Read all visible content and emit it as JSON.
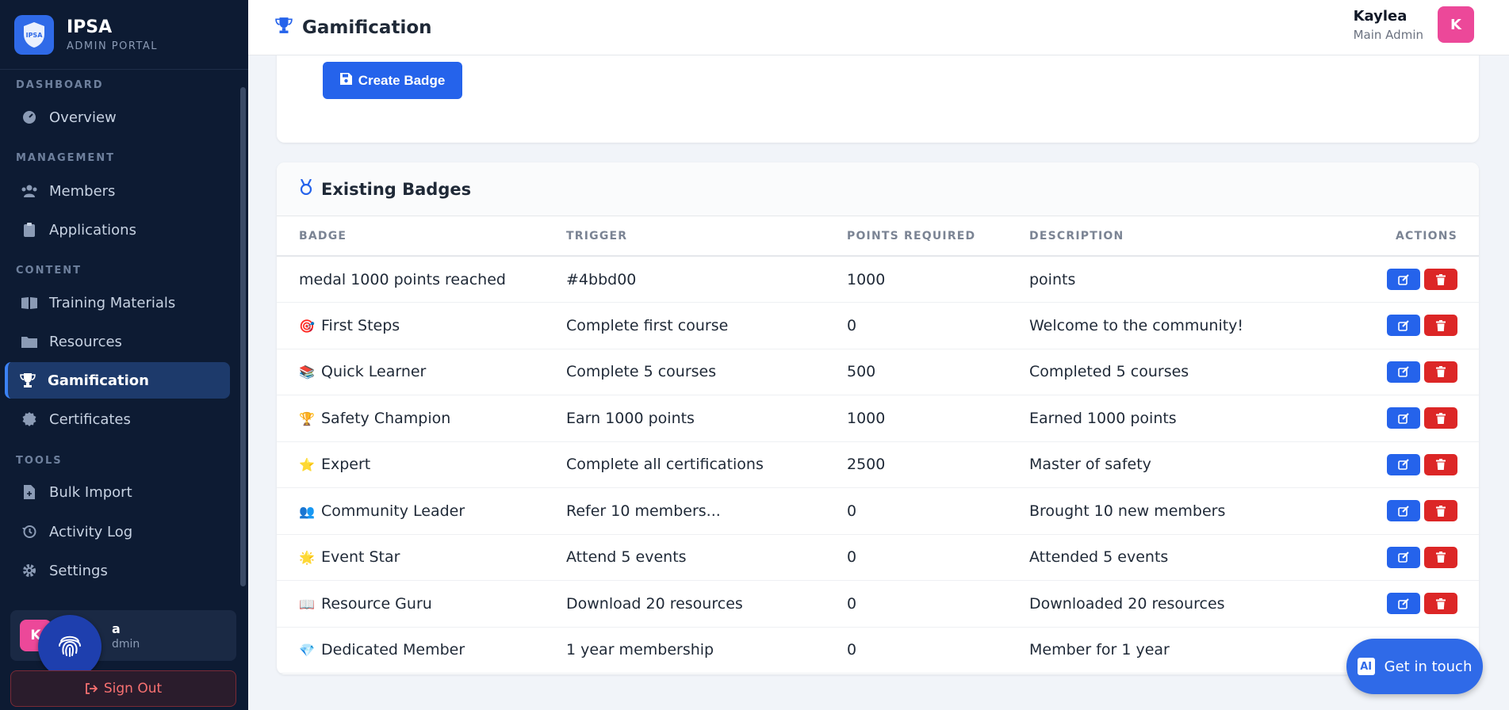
{
  "brand": {
    "title": "IPSA",
    "subtitle": "ADMIN PORTAL",
    "logo_text": "IPSA"
  },
  "sidebar": {
    "sections": [
      "DASHBOARD",
      "MANAGEMENT",
      "CONTENT",
      "TOOLS"
    ],
    "items": [
      {
        "label": "Overview",
        "icon": "gauge-icon"
      },
      {
        "label": "Members",
        "icon": "users-icon"
      },
      {
        "label": "Applications",
        "icon": "clipboard-icon"
      },
      {
        "label": "Training Materials",
        "icon": "book-icon"
      },
      {
        "label": "Resources",
        "icon": "folder-icon"
      },
      {
        "label": "Gamification",
        "icon": "trophy-icon",
        "active": true
      },
      {
        "label": "Certificates",
        "icon": "certificate-icon"
      },
      {
        "label": "Bulk Import",
        "icon": "file-import-icon"
      },
      {
        "label": "Activity Log",
        "icon": "history-icon"
      },
      {
        "label": "Settings",
        "icon": "gear-icon"
      }
    ],
    "user": {
      "initial": "K",
      "name": "a",
      "role": "dmin"
    },
    "signout_label": "Sign Out"
  },
  "header": {
    "title": "Gamification",
    "user_name": "Kaylea",
    "user_role": "Main Admin",
    "user_initial": "K"
  },
  "create": {
    "button_label": "Create Badge"
  },
  "badges": {
    "title": "Existing Badges",
    "columns": [
      "BADGE",
      "TRIGGER",
      "POINTS REQUIRED",
      "DESCRIPTION",
      "ACTIONS"
    ],
    "rows": [
      {
        "emoji": "",
        "name": "medal 1000 points reached",
        "trigger": "#4bbd00",
        "points": "1000",
        "description": "points"
      },
      {
        "emoji": "🎯",
        "name": "First Steps",
        "trigger": "Complete first course",
        "points": "0",
        "description": "Welcome to the community!"
      },
      {
        "emoji": "📚",
        "name": "Quick Learner",
        "trigger": "Complete 5 courses",
        "points": "500",
        "description": "Completed 5 courses"
      },
      {
        "emoji": "🏆",
        "name": "Safety Champion",
        "trigger": "Earn 1000 points",
        "points": "1000",
        "description": "Earned 1000 points"
      },
      {
        "emoji": "⭐",
        "name": "Expert",
        "trigger": "Complete all certifications",
        "points": "2500",
        "description": "Master of safety"
      },
      {
        "emoji": "👥",
        "name": "Community Leader",
        "trigger": "Refer 10 members...",
        "points": "0",
        "description": "Brought 10 new members"
      },
      {
        "emoji": "🌟",
        "name": "Event Star",
        "trigger": "Attend 5 events",
        "points": "0",
        "description": "Attended 5 events"
      },
      {
        "emoji": "📖",
        "name": "Resource Guru",
        "trigger": "Download 20 resources",
        "points": "0",
        "description": "Downloaded 20 resources"
      },
      {
        "emoji": "💎",
        "name": "Dedicated Member",
        "trigger": "1 year membership",
        "points": "0",
        "description": "Member for 1 year"
      }
    ]
  },
  "chat": {
    "ai_label": "AI",
    "label": "Get in touch"
  },
  "colors": {
    "sidebar_bg": "#0d1b33",
    "accent": "#2563eb",
    "danger": "#dc2626",
    "avatar": "#ec4899"
  }
}
